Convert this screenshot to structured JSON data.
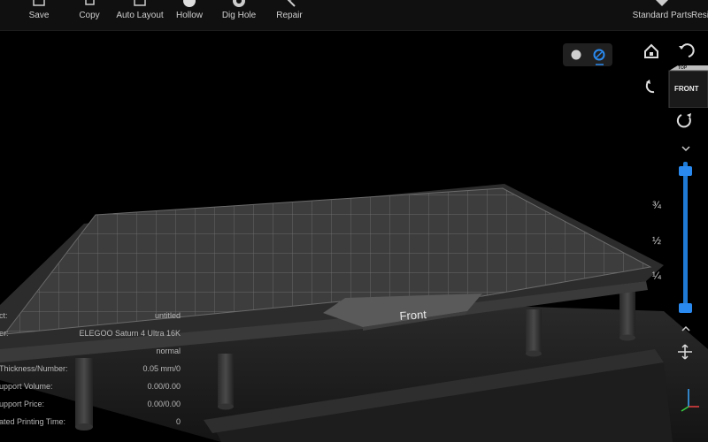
{
  "toolbar": {
    "items": [
      {
        "label": "Save",
        "icon": "save-icon"
      },
      {
        "label": "Copy",
        "icon": "copy-icon"
      },
      {
        "label": "Auto Layout",
        "icon": "auto-layout-icon"
      },
      {
        "label": "Hollow",
        "icon": "hollow-icon"
      },
      {
        "label": "Dig Hole",
        "icon": "dig-hole-icon"
      },
      {
        "label": "Repair",
        "icon": "repair-icon"
      }
    ],
    "right_items": [
      {
        "label": "Standard Parts",
        "icon": "standard-parts-icon"
      },
      {
        "label": "Resi",
        "icon": "resin-icon"
      }
    ]
  },
  "viewport": {
    "plate_label": "Front",
    "view_cube": {
      "front": "FRONT",
      "top": "TOP"
    },
    "render_modes": [
      "solid-shading-icon",
      "wireframe-shading-icon"
    ],
    "active_render_mode": 1
  },
  "slider": {
    "fractions": [
      "¾",
      "½",
      "¼"
    ],
    "top_level": 1.0,
    "bottom_level": 0.0,
    "accent_color": "#1f7ad6"
  },
  "info": {
    "rows": [
      {
        "key": "ct:",
        "value": "untitled"
      },
      {
        "key": "er:",
        "value": "ELEGOO Saturn 4 Ultra 16K"
      },
      {
        "key": "",
        "value": "normal"
      },
      {
        "key": "Thickness/Number:",
        "value": "0.05 mm/0"
      },
      {
        "key": "upport Volume:",
        "value": "0.00/0.00"
      },
      {
        "key": "upport Price:",
        "value": "0.00/0.00"
      },
      {
        "key": "ated Printing Time:",
        "value": "0"
      }
    ]
  },
  "colors": {
    "background": "#000000",
    "plate": "#3d3d3d",
    "grid": "#8a8a8a",
    "accent": "#1f7ad6"
  }
}
